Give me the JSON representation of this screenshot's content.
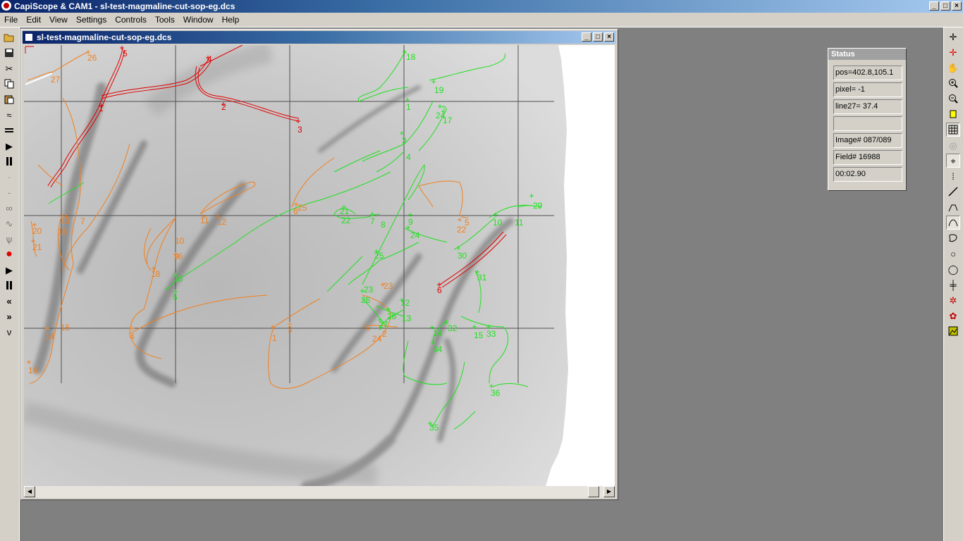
{
  "app": {
    "title": "CapiScope & CAM1 - sl-test-magmaline-cut-sop-eg.dcs",
    "window_buttons": [
      "_",
      "□",
      "×"
    ]
  },
  "menu": [
    "File",
    "Edit",
    "View",
    "Settings",
    "Controls",
    "Tools",
    "Window",
    "Help"
  ],
  "document": {
    "title": "sl-test-magmaline-cut-sop-eg.dcs",
    "window_buttons": [
      "_",
      "□",
      "×"
    ]
  },
  "status": {
    "title": "Status",
    "fields": [
      "pos=402.8,105.1",
      "pixel= -1",
      "line27= 37.4",
      "",
      "Image# 087/089",
      "Field# 16988",
      "00:02.90"
    ]
  },
  "labels": {
    "red": [
      "5",
      "4",
      "1",
      "2",
      "3",
      "6"
    ],
    "orange": [
      "26",
      "27",
      "25",
      "6",
      "11",
      "12",
      "13",
      "7",
      "16",
      "20",
      "21",
      "10",
      "9",
      "16",
      "18",
      "3",
      "1",
      "2",
      "24",
      "5",
      "22",
      "23",
      "14",
      "15",
      "4",
      "16"
    ],
    "green": [
      "18",
      "19",
      "1",
      "2",
      "24",
      "17",
      "3",
      "4",
      "21",
      "22",
      "7",
      "8",
      "9",
      "24",
      "10",
      "11",
      "29",
      "25",
      "30",
      "31",
      "23",
      "26",
      "12",
      "28",
      "13",
      "27",
      "14",
      "32",
      "15",
      "33",
      "34",
      "16",
      "5",
      "36",
      "35"
    ]
  },
  "colors": {
    "red": "#e00000",
    "orange": "#f08020",
    "green": "#20e020",
    "grid": "#505050"
  }
}
